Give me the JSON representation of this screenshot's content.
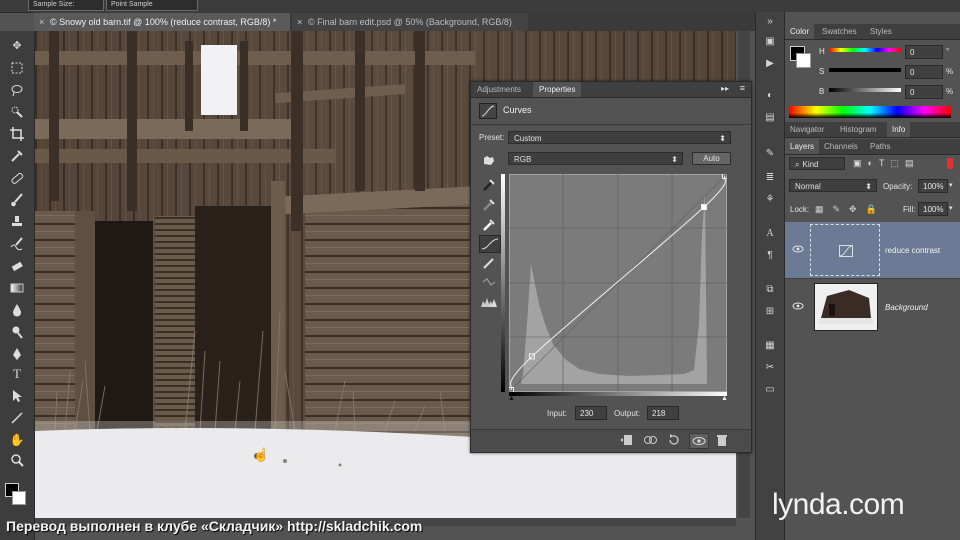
{
  "options_bar": {
    "sample_size": "Sample Size:",
    "sample_value": "Point Sample"
  },
  "document_tabs": [
    {
      "label": "© Snowy old barn.tif @ 100% (reduce contrast, RGB/8) *",
      "close": "×"
    },
    {
      "label": "© Final barn edit.psd @ 50% (Background, RGB/8)",
      "close": "×"
    }
  ],
  "properties_panel": {
    "tabs": [
      "Adjustments",
      "Properties"
    ],
    "title": "Curves",
    "preset_label": "Preset:",
    "preset_value": "Custom",
    "channel_value": "RGB",
    "auto_button": "Auto",
    "input_label": "Input:",
    "input_value": "230",
    "output_label": "Output:",
    "output_value": "218",
    "menu_glyph": "▸▸"
  },
  "curve_points": [
    {
      "input": 0,
      "output": 0
    },
    {
      "input": 25,
      "output": 40
    },
    {
      "input": 230,
      "output": 218
    },
    {
      "input": 255,
      "output": 255
    }
  ],
  "color_panel": {
    "tabs": [
      "Color",
      "Swatches",
      "Styles"
    ],
    "sliders": [
      {
        "label": "H",
        "value": "0",
        "unit": "°"
      },
      {
        "label": "S",
        "value": "0",
        "unit": "%"
      },
      {
        "label": "B",
        "value": "0",
        "unit": "%"
      }
    ]
  },
  "info_panel": {
    "tabs": [
      "Navigator",
      "Histogram",
      "Info"
    ]
  },
  "layers_panel": {
    "tabs": [
      "Layers",
      "Channels",
      "Paths"
    ],
    "kind_label": "Kind",
    "blend_mode": "Normal",
    "opacity_label": "Opacity:",
    "opacity_value": "100%",
    "lock_label": "Lock:",
    "fill_label": "Fill:",
    "fill_value": "100%",
    "layers": [
      {
        "name": "reduce contrast"
      },
      {
        "name": "Background"
      }
    ]
  },
  "watermarks": {
    "russian": "Перевод выполнен в клубе «Складчик» http://skladchik.com",
    "brand": "lynda.com"
  },
  "colors": {
    "panel_bg": "#535353",
    "dark_bg": "#3c3c3c",
    "selected_layer": "#6b7a95",
    "curve_bg": "#7b7b7b"
  }
}
